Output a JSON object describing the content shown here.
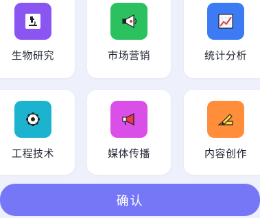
{
  "categories": [
    {
      "label": "生物研究",
      "icon": "microscope-icon",
      "color": "#8a55f0"
    },
    {
      "label": "市场营销",
      "icon": "megaphone-icon",
      "color": "#2bc15f"
    },
    {
      "label": "统计分析",
      "icon": "chart-icon",
      "color": "#3d7bf4"
    },
    {
      "label": "工程技术",
      "icon": "gear-icon",
      "color": "#1cb3cf"
    },
    {
      "label": "媒体传播",
      "icon": "bullhorn-icon",
      "color": "#d94fe8"
    },
    {
      "label": "内容创作",
      "icon": "pen-icon",
      "color": "#ff8d3a"
    }
  ],
  "confirm_label": "确认"
}
